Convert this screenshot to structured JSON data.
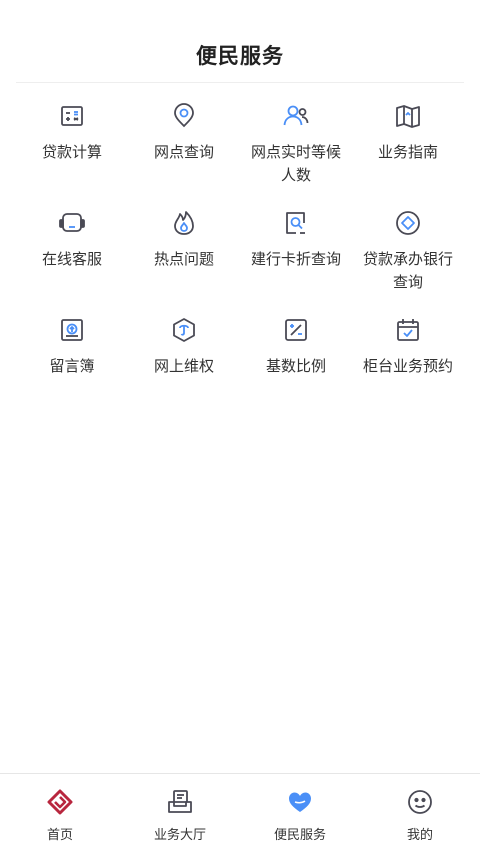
{
  "header": {
    "title": "便民服务"
  },
  "colors": {
    "icon_dark": "#4a4a55",
    "icon_accent": "#4a8ff7",
    "brand_red": "#b8263e"
  },
  "services": [
    {
      "label": "贷款计算",
      "icon": "calculator-icon"
    },
    {
      "label": "网点查询",
      "icon": "location-pin-icon"
    },
    {
      "label": "网点实时等候人数",
      "icon": "people-icon"
    },
    {
      "label": "业务指南",
      "icon": "map-guide-icon"
    },
    {
      "label": "在线客服",
      "icon": "headset-icon"
    },
    {
      "label": "热点问题",
      "icon": "flame-icon"
    },
    {
      "label": "建行卡折查询",
      "icon": "card-search-icon"
    },
    {
      "label": "贷款承办银行查询",
      "icon": "diamond-circle-icon"
    },
    {
      "label": "留言簿",
      "icon": "message-board-icon"
    },
    {
      "label": "网上维权",
      "icon": "shield-rights-icon"
    },
    {
      "label": "基数比例",
      "icon": "percentage-icon"
    },
    {
      "label": "柜台业务预约",
      "icon": "calendar-check-icon"
    }
  ],
  "tabbar": {
    "items": [
      {
        "label": "首页",
        "icon": "home-logo-icon"
      },
      {
        "label": "业务大厅",
        "icon": "business-hall-icon"
      },
      {
        "label": "便民服务",
        "icon": "heart-hand-icon",
        "active": true
      },
      {
        "label": "我的",
        "icon": "smiley-profile-icon"
      }
    ]
  }
}
